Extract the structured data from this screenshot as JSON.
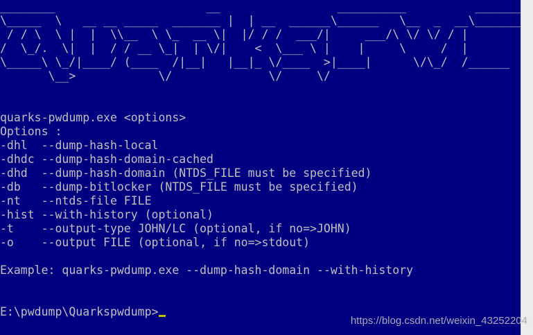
{
  "console": {
    "banner_lines": [
      "________                      __                 __________          _________",
      "\\_____  \\   __ __ _____  _______ |  | __  ______\\______   \\__  _  __\\_______",
      " / / \\  \\ |  |  \\\\__  \\ \\_  __ \\|  |/ / /  ___/|     ___/\\ \\/ \\/ / |",
      "/  \\_/.  \\|  |  / / __ \\_|  | \\/|    <  \\___ \\ |    |     \\     /  |",
      "\\_____\\ \\_/|____/ (____  /|__|   |__|_ \\/____  >|____|      \\/\\_/  /______",
      "       \\__>            \\/              \\/     \\/"
    ],
    "output_lines": [
      "quarks-pwdump.exe <options>",
      "Options :",
      "-dhl  --dump-hash-local",
      "-dhdc --dump-hash-domain-cached",
      "-dhd  --dump-hash-domain (NTDS_FILE must be specified)",
      "-db   --dump-bitlocker (NTDS_FILE must be specified)",
      "-nt   --ntds-file FILE",
      "-hist --with-history (optional)",
      "-t    --output-type JOHN/LC (optional, if no=>JOHN)",
      "-o    --output FILE (optional, if no=>stdout)",
      "",
      "Example: quarks-pwdump.exe --dump-hash-domain --with-history"
    ],
    "prompt": "E:\\pwdump\\Quarkspwdump>"
  },
  "watermark": "https://blog.csdn.net/weixin_43252204",
  "colors": {
    "console_background": "#000080",
    "console_text": "#c0c0c0",
    "cursor": "#c0c000"
  }
}
